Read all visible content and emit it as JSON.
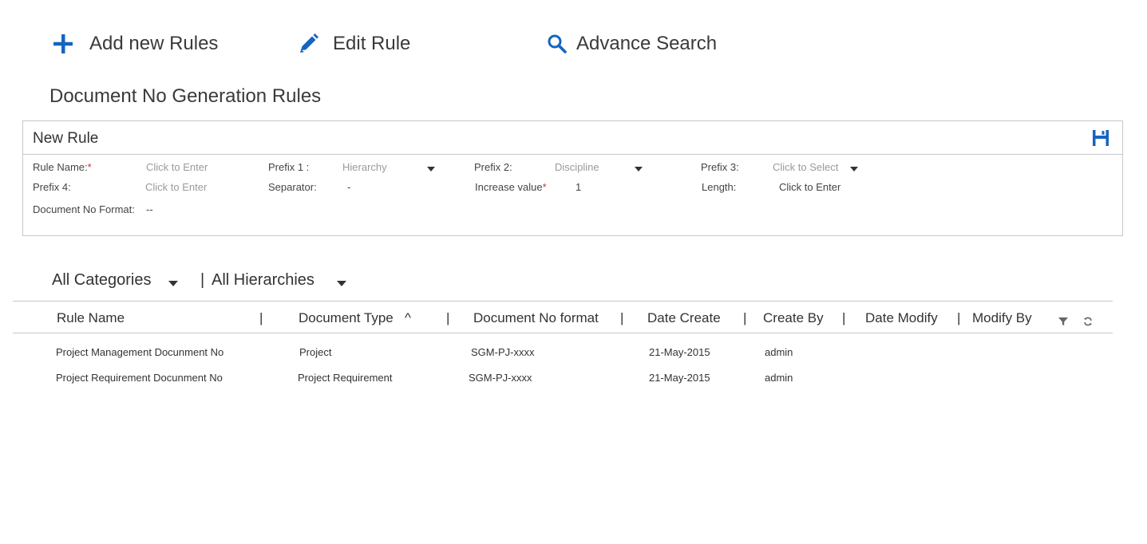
{
  "toolbar": {
    "add_label": "Add new Rules",
    "edit_label": "Edit Rule",
    "search_label": "Advance Search",
    "accent_color": "#1565c0"
  },
  "page_title": "Document No Generation Rules",
  "new_rule": {
    "title": "New Rule",
    "fields": {
      "rule_name": {
        "label": "Rule Name:",
        "required_mark": "*",
        "placeholder": "Click to Enter"
      },
      "prefix1": {
        "label": "Prefix 1 :",
        "placeholder": "Hierarchy"
      },
      "prefix2": {
        "label": "Prefix 2:",
        "placeholder": "Discipline"
      },
      "prefix3": {
        "label": "Prefix 3:",
        "placeholder": "Click to Select"
      },
      "prefix4": {
        "label": "Prefix 4:",
        "placeholder": "Click to Enter"
      },
      "separator": {
        "label": "Separator:",
        "value": "-"
      },
      "increase_value": {
        "label": "Increase value",
        "required_mark": "*",
        "value": "1"
      },
      "length": {
        "label": "Length:",
        "value": "Click to Enter"
      },
      "doc_no_format": {
        "label": "Document No Format:",
        "value": "--"
      }
    }
  },
  "filters": {
    "categories": "All Categories",
    "hierarchies_sep": "|",
    "hierarchies": "All Hierarchies"
  },
  "table": {
    "separator": "|",
    "columns": {
      "rule_name": "Rule  Name",
      "document_type": "Document Type",
      "sort_indicator": "^",
      "doc_no_format": "Document No format",
      "date_create": "Date Create",
      "create_by": "Create By",
      "date_modify": "Date Modify",
      "modify_by": "Modify  By"
    },
    "rows": [
      {
        "rule_name": "Project  Management Docunment No",
        "document_type": "Project",
        "doc_no_format": "SGM-PJ-xxxx",
        "date_create": "21-May-2015",
        "create_by": "admin"
      },
      {
        "rule_name": "Project  Requirement Docunment No",
        "document_type": "Project  Requirement",
        "doc_no_format": "SGM-PJ-xxxx",
        "date_create": "21-May-2015",
        "create_by": "admin"
      }
    ]
  }
}
